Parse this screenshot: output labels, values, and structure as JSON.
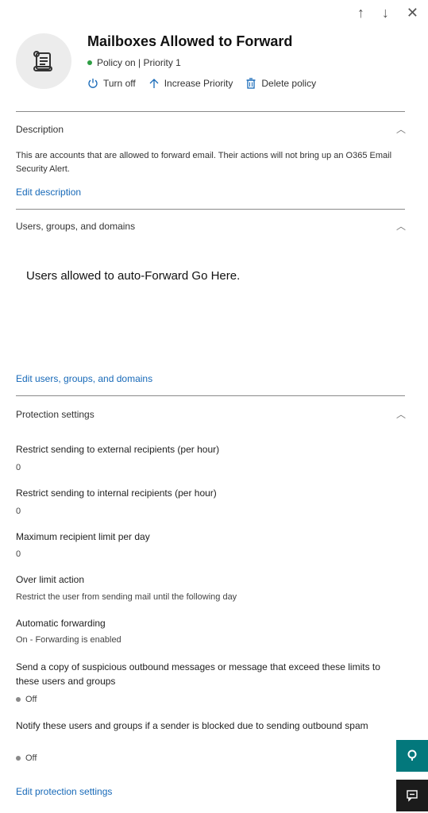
{
  "nav": {
    "up_icon": "↑",
    "down_icon": "↓",
    "close_icon": "✕"
  },
  "header": {
    "title": "Mailboxes Allowed to Forward",
    "status": "Policy on | Priority 1",
    "status_color": "#2e9e44",
    "actions": {
      "turn_off": "Turn off",
      "increase_priority": "Increase Priority",
      "delete_policy": "Delete policy"
    }
  },
  "description": {
    "title": "Description",
    "text": "This are accounts that are allowed to forward email. Their actions will not bring up an O365 Email Security Alert.",
    "edit_link": "Edit description"
  },
  "users": {
    "title": "Users, groups, and domains",
    "placeholder_text": "Users allowed to auto-Forward Go Here.",
    "edit_link": "Edit users, groups, and domains"
  },
  "protection": {
    "title": "Protection settings",
    "fields": [
      {
        "label": "Restrict sending to external recipients (per hour)",
        "value": "0"
      },
      {
        "label": "Restrict sending to internal recipients (per hour)",
        "value": "0"
      },
      {
        "label": "Maximum recipient limit per day",
        "value": "0"
      },
      {
        "label": "Over limit action",
        "value": "Restrict the user from sending mail until the following day"
      },
      {
        "label": "Automatic forwarding",
        "value": "On - Forwarding is enabled"
      },
      {
        "label": "Send a copy of suspicious outbound messages or message that exceed these limits to these users and groups",
        "value": "Off"
      },
      {
        "label": "Notify these users and groups if a sender is blocked due to sending outbound spam",
        "value": "Off"
      }
    ],
    "edit_link": "Edit protection settings"
  },
  "colors": {
    "link": "#1769b8",
    "side_teal": "#03787c",
    "side_dark": "#1b1b1b",
    "off_dot": "#8a8a8a"
  }
}
